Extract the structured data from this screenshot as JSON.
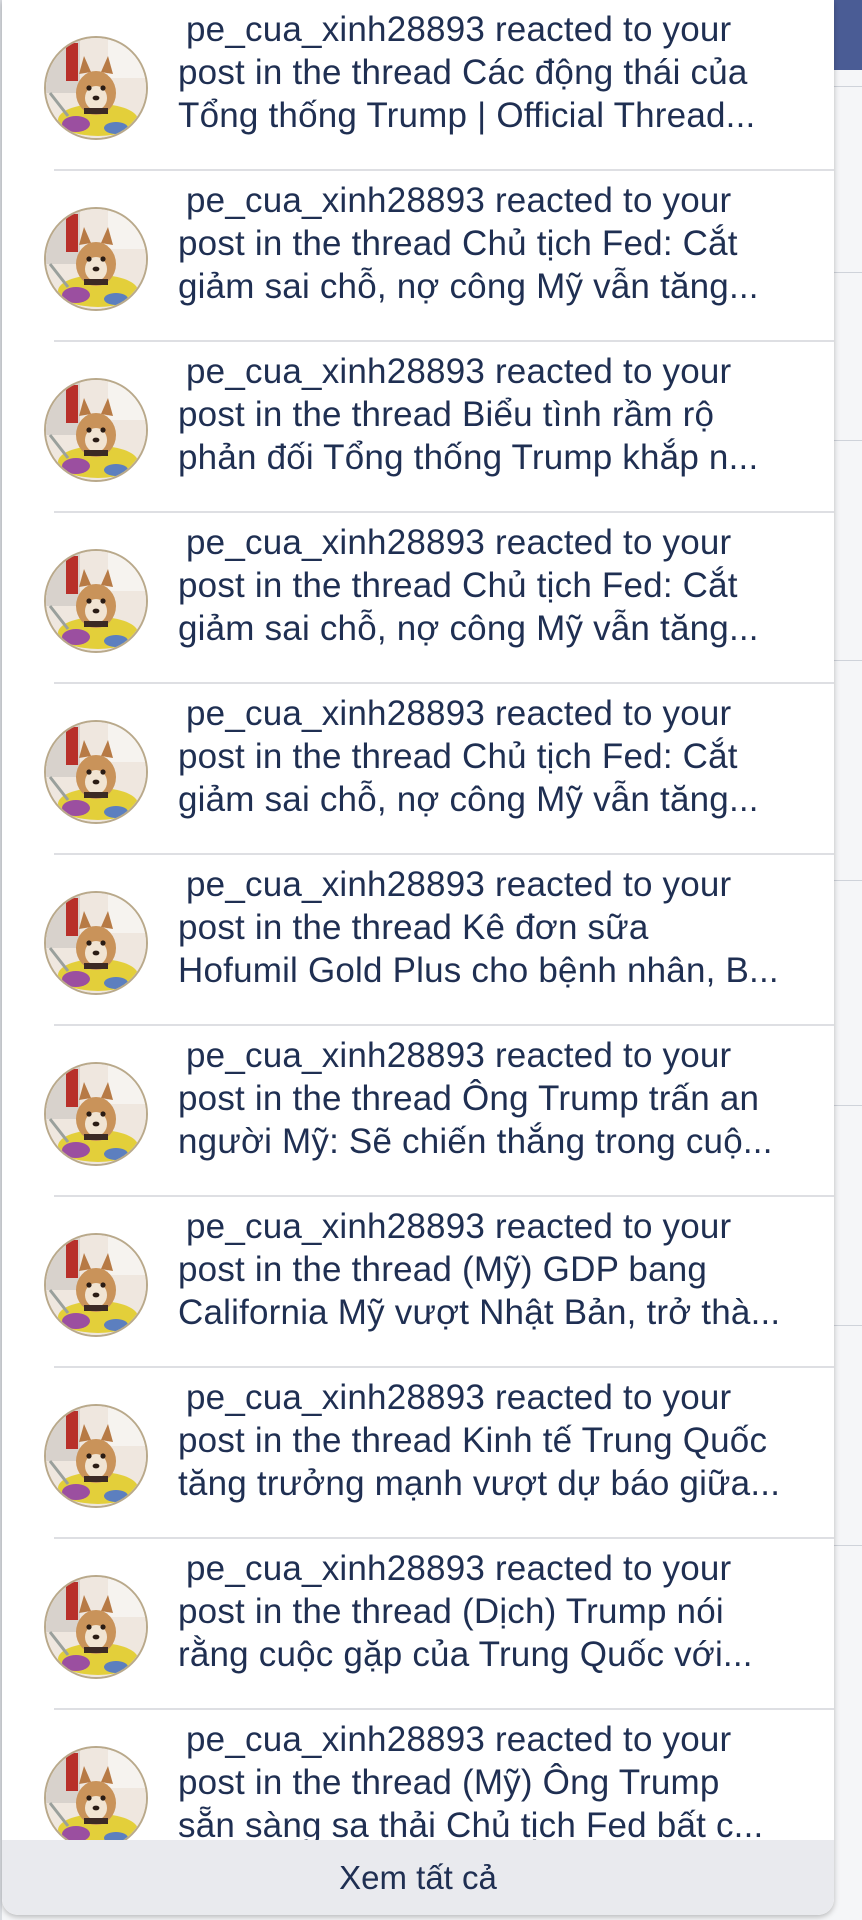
{
  "notifications": [
    {
      "line1": "pe_cua_xinh28893 reacted to your",
      "line2": "post in the thread Các động thái của",
      "line3": "Tổng thống Trump | Official Thread..."
    },
    {
      "line1": "pe_cua_xinh28893 reacted to your",
      "line2": "post in the thread Chủ tịch Fed: Cắt",
      "line3": "giảm sai chỗ, nợ công Mỹ vẫn tăng..."
    },
    {
      "line1": "pe_cua_xinh28893 reacted to your",
      "line2": "post in the thread Biểu tình rầm rộ",
      "line3": "phản đối Tổng thống Trump khắp n..."
    },
    {
      "line1": "pe_cua_xinh28893 reacted to your",
      "line2": "post in the thread Chủ tịch Fed: Cắt",
      "line3": "giảm sai chỗ, nợ công Mỹ vẫn tăng..."
    },
    {
      "line1": "pe_cua_xinh28893 reacted to your",
      "line2": "post in the thread Chủ tịch Fed: Cắt",
      "line3": "giảm sai chỗ, nợ công Mỹ vẫn tăng..."
    },
    {
      "line1": "pe_cua_xinh28893 reacted to your",
      "line2": "post in the thread Kê đơn sữa",
      "line3": "Hofumil Gold Plus cho bệnh nhân, B..."
    },
    {
      "line1": "pe_cua_xinh28893 reacted to your",
      "line2": "post in the thread Ông Trump trấn an",
      "line3": "người Mỹ: Sẽ chiến thắng trong cuộ..."
    },
    {
      "line1": "pe_cua_xinh28893 reacted to your",
      "line2": "post in the thread (Mỹ) GDP bang",
      "line3": "California Mỹ vượt Nhật Bản, trở thà..."
    },
    {
      "line1": "pe_cua_xinh28893 reacted to your",
      "line2": "post in the thread Kinh tế Trung Quốc",
      "line3": "tăng trưởng mạnh vượt dự báo giữa..."
    },
    {
      "line1": "pe_cua_xinh28893 reacted to your",
      "line2": "post in the thread (Dịch) Trump nói",
      "line3": "rằng cuộc gặp của Trung Quốc với..."
    },
    {
      "line1": "pe_cua_xinh28893 reacted to your",
      "line2": "post in the thread (Mỹ) Ông Trump",
      "line3": "sẵn sàng sa thải Chủ tịch Fed bất c..."
    }
  ],
  "footer": {
    "see_all_label": "Xem tất cả"
  },
  "avatar": {
    "icon": "dog-avatar-icon"
  },
  "colors": {
    "text": "#1f2f52",
    "footer_bg": "#e9eaee",
    "divider": "#dedfe3",
    "header_accent": "#4a5c95"
  }
}
